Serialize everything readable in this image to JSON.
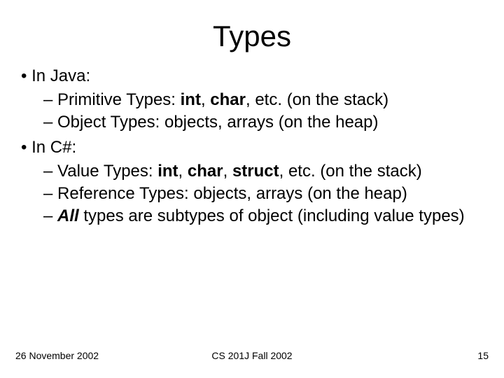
{
  "title": "Types",
  "sections": {
    "java": {
      "heading": "In Java:",
      "b1_prefix": "Primitive Types: ",
      "b1_kw1": "int",
      "b1_sep": ", ",
      "b1_kw2": "char",
      "b1_suffix": ", etc. (on the stack)",
      "b2": "Object Types: objects, arrays (on the heap)"
    },
    "csharp": {
      "heading": "In C#:",
      "b1_prefix": "Value Types: ",
      "b1_kw1": "int",
      "b1_sep1": ", ",
      "b1_kw2": "char",
      "b1_sep2": ", ",
      "b1_kw3": "struct",
      "b1_suffix": ", etc. (on the stack)",
      "b2": "Reference Types: objects, arrays (on the heap)",
      "b3_kw": "All",
      "b3_rest": " types are subtypes of object (including value types)"
    }
  },
  "footer": {
    "date": "26 November 2002",
    "course": "CS 201J Fall 2002",
    "page": "15"
  },
  "bullet": "• ",
  "dash": "– "
}
